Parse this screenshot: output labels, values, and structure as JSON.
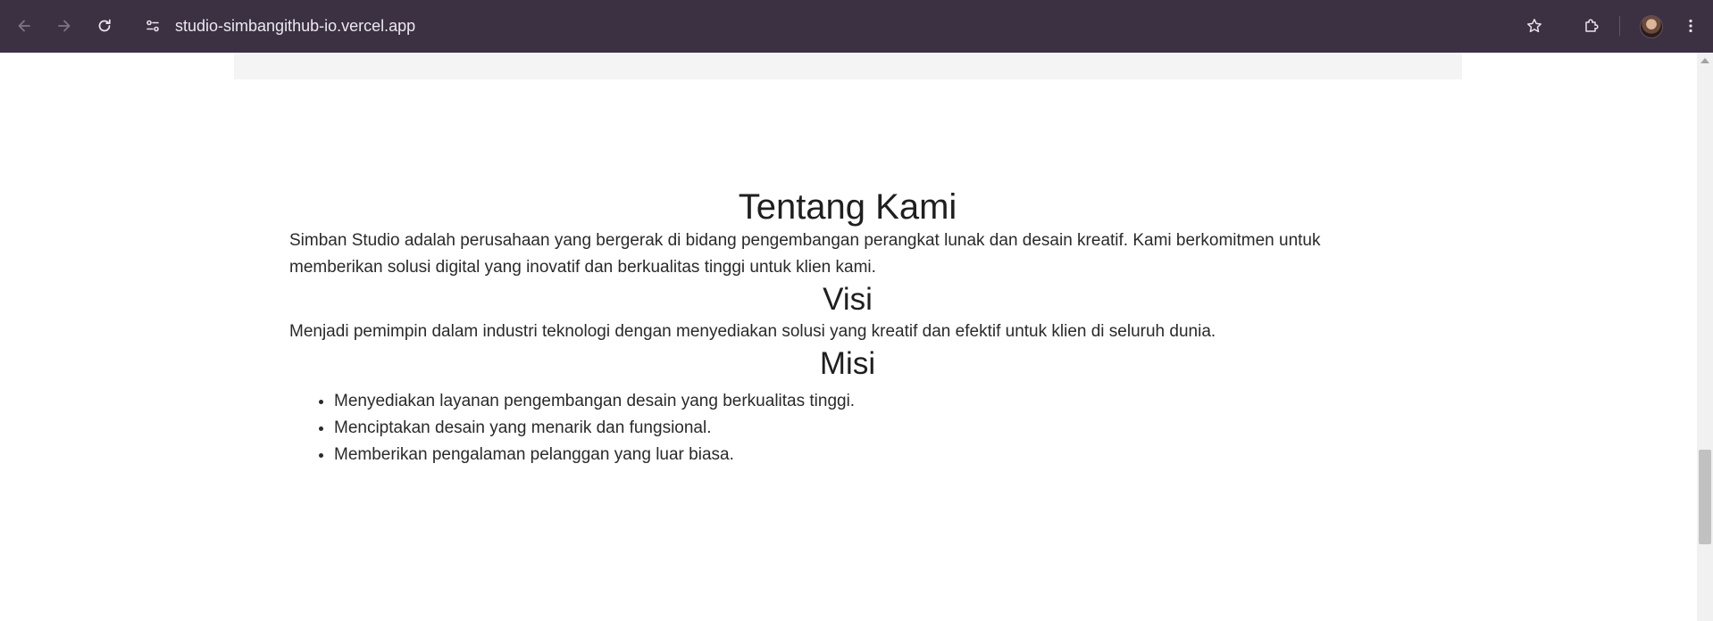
{
  "browser": {
    "url": "studio-simbangithub-io.vercel.app",
    "icons": [
      "back-arrow-icon",
      "forward-arrow-icon",
      "reload-icon",
      "site-settings-icon",
      "star-icon",
      "extensions-icon",
      "avatar",
      "more-vert-icon"
    ]
  },
  "about": {
    "title": "Tentang Kami",
    "description": "Simban Studio adalah perusahaan yang bergerak di bidang pengembangan perangkat lunak dan desain kreatif. Kami berkomitmen untuk memberikan solusi digital yang inovatif dan berkualitas tinggi untuk klien kami.",
    "visi_title": "Visi",
    "visi_text": "Menjadi pemimpin dalam industri teknologi dengan menyediakan solusi yang kreatif dan efektif untuk klien di seluruh dunia.",
    "misi_title": "Misi",
    "misi_items": [
      "Menyediakan layanan pengembangan desain yang berkualitas tinggi.",
      "Menciptakan desain yang menarik dan fungsional.",
      "Memberikan pengalaman pelanggan yang luar biasa."
    ]
  },
  "colors": {
    "toolbar_bg": "#3b3142",
    "text": "#222222",
    "gray_band": "#f4f4f4"
  }
}
